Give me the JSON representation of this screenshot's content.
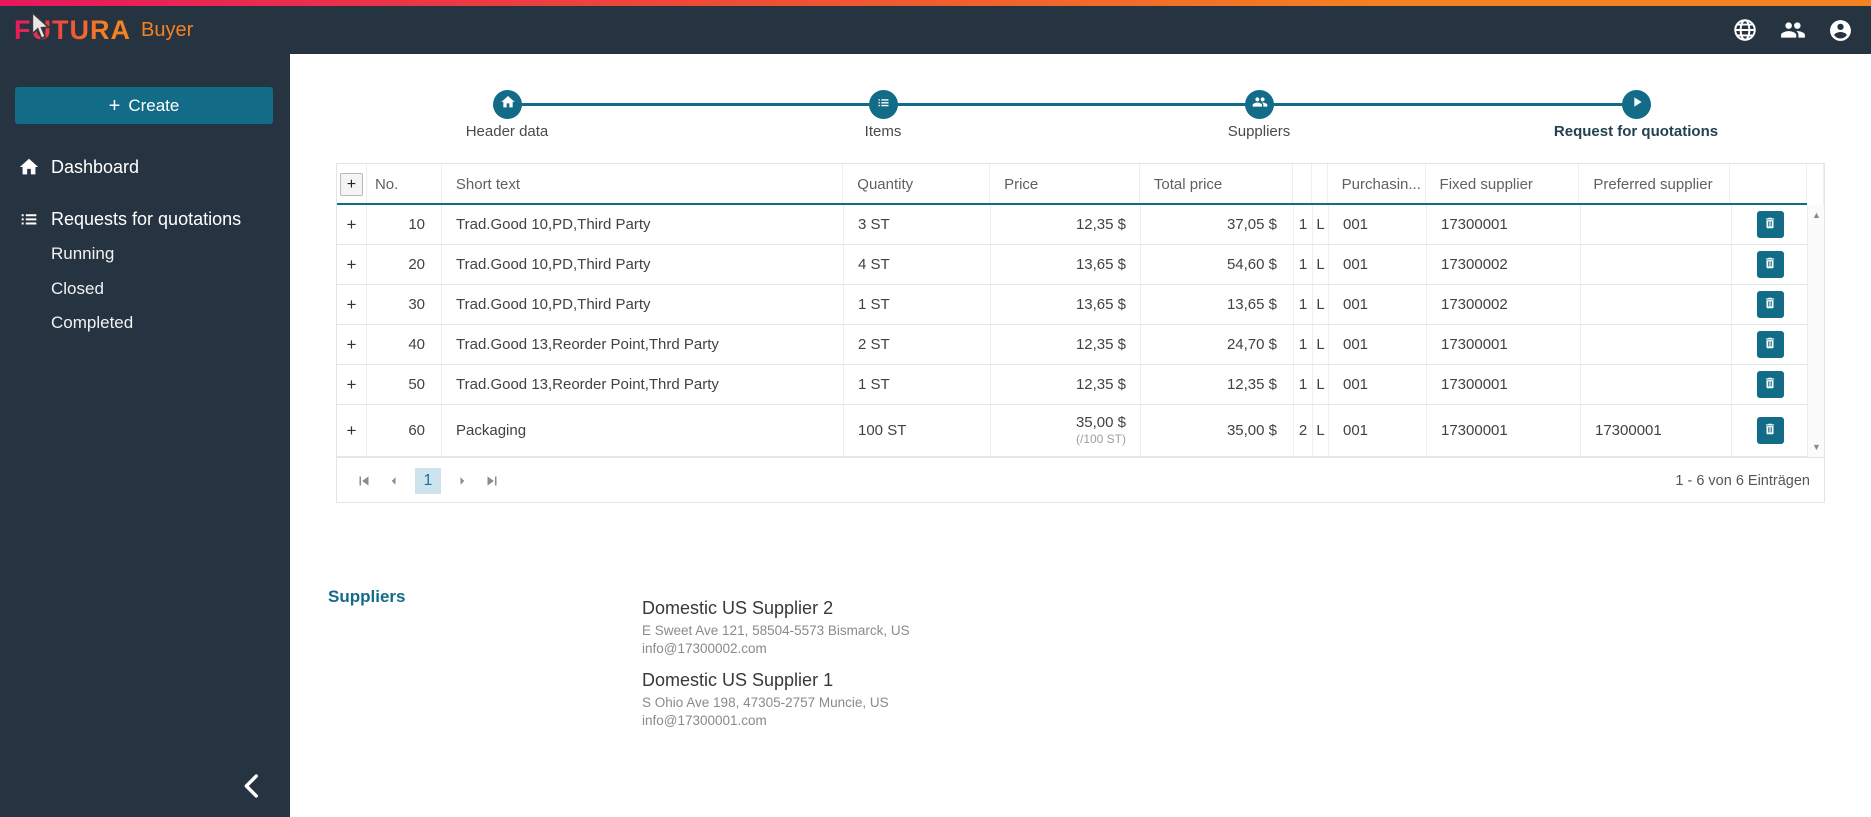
{
  "topbar": {
    "brand": "FUTURA",
    "product": "Buyer"
  },
  "sidebar": {
    "create_label": "Create",
    "create_plus": "+",
    "items": [
      {
        "label": "Dashboard"
      },
      {
        "label": "Requests for quotations"
      }
    ],
    "subitems": [
      {
        "label": "Running"
      },
      {
        "label": "Closed"
      },
      {
        "label": "Completed"
      }
    ]
  },
  "stepper": {
    "steps": [
      {
        "label": "Header data"
      },
      {
        "label": "Items"
      },
      {
        "label": "Suppliers"
      },
      {
        "label": "Request for quotations"
      }
    ]
  },
  "table": {
    "expand_symbol": "+",
    "columns": {
      "expand": "+",
      "no": "No.",
      "short_text": "Short text",
      "quantity": "Quantity",
      "price": "Price",
      "total_price": "Total price",
      "purchasing": "Purchasin...",
      "fixed_supplier": "Fixed supplier",
      "preferred_supplier": "Preferred supplier"
    },
    "rows": [
      {
        "no": "10",
        "short_text": "Trad.Good 10,PD,Third Party",
        "quantity": "3 ST",
        "price": "12,35 $",
        "price_note": "",
        "total": "37,05 $",
        "c1": "1",
        "c2": "L",
        "purchasing": "001",
        "fixed": "17300001",
        "preferred": ""
      },
      {
        "no": "20",
        "short_text": "Trad.Good 10,PD,Third Party",
        "quantity": "4 ST",
        "price": "13,65 $",
        "price_note": "",
        "total": "54,60 $",
        "c1": "1",
        "c2": "L",
        "purchasing": "001",
        "fixed": "17300002",
        "preferred": ""
      },
      {
        "no": "30",
        "short_text": "Trad.Good 10,PD,Third Party",
        "quantity": "1 ST",
        "price": "13,65 $",
        "price_note": "",
        "total": "13,65 $",
        "c1": "1",
        "c2": "L",
        "purchasing": "001",
        "fixed": "17300002",
        "preferred": ""
      },
      {
        "no": "40",
        "short_text": "Trad.Good 13,Reorder Point,Thrd Party",
        "quantity": "2 ST",
        "price": "12,35 $",
        "price_note": "",
        "total": "24,70 $",
        "c1": "1",
        "c2": "L",
        "purchasing": "001",
        "fixed": "17300001",
        "preferred": ""
      },
      {
        "no": "50",
        "short_text": "Trad.Good 13,Reorder Point,Thrd Party",
        "quantity": "1 ST",
        "price": "12,35 $",
        "price_note": "",
        "total": "12,35 $",
        "c1": "1",
        "c2": "L",
        "purchasing": "001",
        "fixed": "17300001",
        "preferred": ""
      },
      {
        "no": "60",
        "short_text": "Packaging",
        "quantity": "100 ST",
        "price": "35,00 $",
        "price_note": "(/100 ST)",
        "total": "35,00 $",
        "c1": "2",
        "c2": "L",
        "purchasing": "001",
        "fixed": "17300001",
        "preferred": "17300001"
      }
    ]
  },
  "pagination": {
    "current_page": "1",
    "summary": "1 - 6 von 6 Einträgen"
  },
  "suppliers": {
    "heading": "Suppliers",
    "list": [
      {
        "name": "Domestic US Supplier 2",
        "address": "E Sweet Ave 121, 58504-5573 Bismarck, US",
        "email": "info@17300002.com"
      },
      {
        "name": "Domestic US Supplier 1",
        "address": "S Ohio Ave 198, 47305-2757 Muncie, US",
        "email": "info@17300001.com"
      }
    ]
  },
  "colors": {
    "accent_teal": "#136c87",
    "brand_pink": "#e8175d",
    "brand_orange": "#f58220",
    "dark_navy": "#263340",
    "page_indicator_bg": "#cde3ed"
  }
}
